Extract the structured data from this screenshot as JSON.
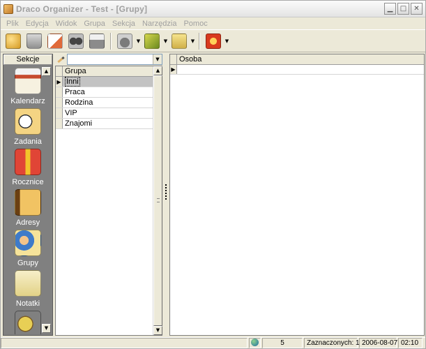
{
  "window": {
    "title": "Draco Organizer - Test - [Grupy]",
    "controls": [
      "minimize-icon",
      "maximize-icon",
      "close-icon"
    ]
  },
  "menu": [
    "Plik",
    "Edycja",
    "Widok",
    "Grupa",
    "Sekcja",
    "Narzędzia",
    "Pomoc"
  ],
  "toolbar": {
    "buttons": [
      "persons-icon",
      "trash-icon",
      "edit-icon",
      "binoculars-icon",
      "printer-icon",
      "phone-icon",
      "tools-icon",
      "add-icon",
      "sync-icon"
    ]
  },
  "sidebar": {
    "header": "Sekcje",
    "items": [
      {
        "label": "Kalendarz",
        "icon": "calendar-icon"
      },
      {
        "label": "Zadania",
        "icon": "clock-icon"
      },
      {
        "label": "Rocznice",
        "icon": "gift-icon"
      },
      {
        "label": "Adresy",
        "icon": "address-book-icon"
      },
      {
        "label": "Grupy",
        "icon": "group-icon"
      },
      {
        "label": "Notatki",
        "icon": "notes-icon"
      }
    ]
  },
  "groups": {
    "search_value": "",
    "column": "Grupa",
    "rows": [
      "Inni",
      "Praca",
      "Rodzina",
      "VIP",
      "Znajomi"
    ],
    "selected_index": 0
  },
  "persons": {
    "column": "Osoba"
  },
  "status": {
    "count": "5",
    "selected": "Zaznaczonych: 1",
    "date": "2006-08-07",
    "time": "02:10"
  },
  "colors": {
    "sidebar_bg": "#808080",
    "window_bg": "#ece9d8",
    "disabled_text": "#a0a0a0",
    "selected_row": "#c3c3c3"
  }
}
